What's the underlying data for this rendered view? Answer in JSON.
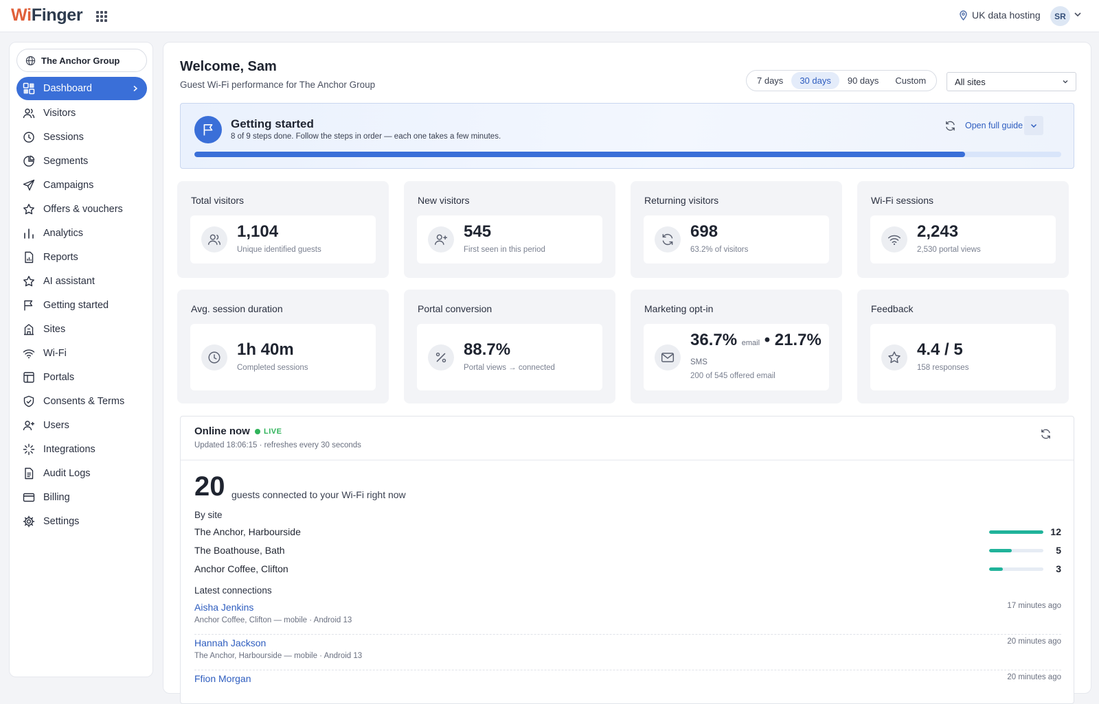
{
  "header": {
    "logo_wi": "Wi",
    "logo_finger": "Finger",
    "hosting_label": "UK data hosting",
    "user_initials": "SR"
  },
  "sidebar": {
    "org_name": "The Anchor Group",
    "items": [
      {
        "label": "Dashboard",
        "icon": "dashboard-icon",
        "active": true
      },
      {
        "label": "Visitors",
        "icon": "users-icon"
      },
      {
        "label": "Sessions",
        "icon": "clock-icon"
      },
      {
        "label": "Segments",
        "icon": "pie-icon"
      },
      {
        "label": "Campaigns",
        "icon": "send-icon"
      },
      {
        "label": "Offers & vouchers",
        "icon": "star-icon"
      },
      {
        "label": "Analytics",
        "icon": "bar-chart-icon"
      },
      {
        "label": "Reports",
        "icon": "report-icon"
      },
      {
        "label": "AI assistant",
        "icon": "star-icon"
      },
      {
        "label": "Getting started",
        "icon": "flag-icon"
      },
      {
        "label": "Sites",
        "icon": "building-icon"
      },
      {
        "label": "Wi-Fi",
        "icon": "wifi-icon"
      },
      {
        "label": "Portals",
        "icon": "layout-icon"
      },
      {
        "label": "Consents & Terms",
        "icon": "shield-icon"
      },
      {
        "label": "Users",
        "icon": "user-plus-icon"
      },
      {
        "label": "Integrations",
        "icon": "integrations-icon"
      },
      {
        "label": "Audit Logs",
        "icon": "document-icon"
      },
      {
        "label": "Billing",
        "icon": "card-icon"
      },
      {
        "label": "Settings",
        "icon": "gear-icon"
      }
    ]
  },
  "main": {
    "welcome": "Welcome, Sam",
    "subtitle": "Guest Wi-Fi performance for The Anchor Group",
    "ranges": [
      "7 days",
      "30 days",
      "90 days",
      "Custom"
    ],
    "active_range": "30 days",
    "site_filter": "All sites"
  },
  "getting_started": {
    "title": "Getting started",
    "description": "8 of 9 steps done. Follow the steps in order — each one takes a few minutes.",
    "guide_link": "Open full guide",
    "progress": 0.889
  },
  "metrics": [
    {
      "title": "Total visitors",
      "value": "1,104",
      "sub": "Unique identified guests",
      "icon": "users-icon"
    },
    {
      "title": "New visitors",
      "value": "545",
      "sub": "First seen in this period",
      "icon": "user-plus-icon"
    },
    {
      "title": "Returning visitors",
      "value": "698",
      "sub": "63.2% of visitors",
      "icon": "refresh-icon"
    },
    {
      "title": "Wi-Fi sessions",
      "value": "2,243",
      "sub": "2,530 portal views",
      "icon": "wifi-icon"
    },
    {
      "title": "Avg. session duration",
      "value": "1h 40m",
      "sub": "Completed sessions",
      "icon": "clock-icon"
    },
    {
      "title": "Portal conversion",
      "value": "88.7%",
      "sub": "Portal views → connected",
      "icon": "percent-icon"
    },
    {
      "title": "Marketing opt-in",
      "value_email": "36.7%",
      "email_label": "email",
      "separator": "•",
      "value_sms": "21.7%",
      "sms_label": "SMS",
      "sub": "200 of 545 offered email",
      "icon": "mail-icon"
    },
    {
      "title": "Feedback",
      "value": "4.4 / 5",
      "sub": "158 responses",
      "icon": "star-icon"
    }
  ],
  "online": {
    "title": "Online now",
    "live_label": "LIVE",
    "updated": "Updated 18:06:15 · refreshes every 30 seconds",
    "count": "20",
    "count_label": "guests connected to your Wi-Fi right now",
    "by_site_label": "By site",
    "sites": [
      {
        "name": "The Anchor, Harbourside",
        "count": 12
      },
      {
        "name": "The Boathouse, Bath",
        "count": 5
      },
      {
        "name": "Anchor Coffee, Clifton",
        "count": 3
      }
    ],
    "latest_label": "Latest connections",
    "connections": [
      {
        "name": "Aisha Jenkins",
        "meta": "Anchor Coffee, Clifton — mobile · Android 13",
        "time": "17 minutes ago"
      },
      {
        "name": "Hannah Jackson",
        "meta": "The Anchor, Harbourside — mobile · Android 13",
        "time": "20 minutes ago"
      },
      {
        "name": "Ffion Morgan",
        "meta": "",
        "time": "20 minutes ago"
      }
    ]
  },
  "colors": {
    "accent": "#3a6fd8",
    "live": "#2fb35a",
    "site_bar": "#20b39a",
    "logo_wi": "#e0603a",
    "logo_finger": "#2d3b4e"
  }
}
